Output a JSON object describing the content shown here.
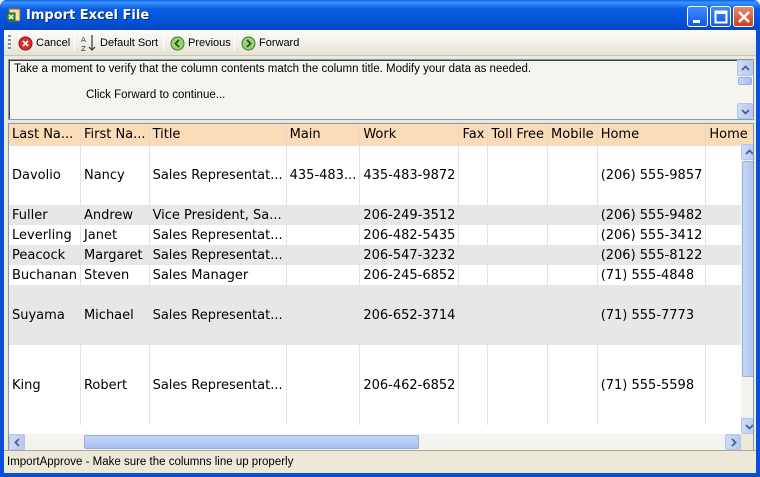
{
  "window": {
    "title": "Import Excel File"
  },
  "toolbar": {
    "cancel_label": "Cancel",
    "sort_label": "Default Sort",
    "previous_label": "Previous",
    "forward_label": "Forward"
  },
  "info": {
    "line1": "Take a moment to verify that the column contents match the column title.  Modify your data as needed.",
    "line2": "Click Forward to continue..."
  },
  "grid": {
    "columns": [
      "Last Na...",
      "First Na...",
      "Title",
      "Main",
      "Work",
      "Fax",
      "Toll Free",
      "Mobile",
      "Home",
      "Home Fa"
    ],
    "rows": [
      [
        "Davolio",
        "Nancy",
        "Sales Representat...",
        "435-483...",
        "435-483-9872",
        "",
        "",
        "",
        "(206) 555-9857",
        ""
      ],
      [
        "Fuller",
        "Andrew",
        "Vice President, Sa...",
        "",
        "206-249-3512",
        "",
        "",
        "",
        "(206) 555-9482",
        ""
      ],
      [
        "Leverling",
        "Janet",
        "Sales Representat...",
        "",
        "206-482-5435",
        "",
        "",
        "",
        "(206) 555-3412",
        ""
      ],
      [
        "Peacock",
        "Margaret",
        "Sales Representat...",
        "",
        "206-547-3232",
        "",
        "",
        "",
        "(206) 555-8122",
        ""
      ],
      [
        "Buchanan",
        "Steven",
        "Sales Manager",
        "",
        "206-245-6852",
        "",
        "",
        "",
        "(71) 555-4848",
        ""
      ],
      [
        "Suyama",
        "Michael",
        "Sales Representat...",
        "",
        "206-652-3714",
        "",
        "",
        "",
        "(71) 555-7773",
        ""
      ],
      [
        "King",
        "Robert",
        "Sales Representat...",
        "",
        "206-462-6852",
        "",
        "",
        "",
        "(71) 555-5598",
        ""
      ]
    ]
  },
  "status": {
    "text": "ImportApprove - Make sure the columns line up properly"
  },
  "icons": {
    "app": "excel-import-icon",
    "cancel": "cancel-icon",
    "sort": "sort-az-icon",
    "previous": "previous-icon",
    "forward": "forward-icon"
  },
  "colors": {
    "title_bar": "#0353d8",
    "column_header": "#fcdcb8",
    "alt_row": "#e7e7e7"
  }
}
